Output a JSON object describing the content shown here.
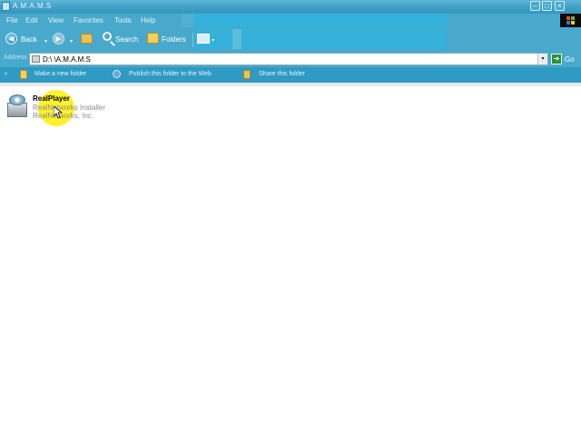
{
  "window": {
    "title": "A.M.A.M.S",
    "minimize_glyph": "–",
    "maximize_glyph": "□",
    "close_glyph": "×"
  },
  "menu": {
    "items": [
      "File",
      "Edit",
      "View",
      "Favorites",
      "Tools",
      "Help"
    ]
  },
  "toolbar": {
    "back_label": "Back",
    "search_label": "Search",
    "folders_label": "Folders",
    "back_glyph": "◀",
    "forward_glyph": "▶",
    "caret_glyph": "▾"
  },
  "address": {
    "label": "Address",
    "value": "D:\\ \\A.M.A.M.S",
    "go_label": "Go",
    "go_glyph": "➜",
    "dropdown_glyph": "▾"
  },
  "tasks": {
    "close_glyph": "✕",
    "items": [
      "Make a new folder",
      "Publish this folder to the Web",
      "Share this folder"
    ]
  },
  "files": [
    {
      "name": "RealPlayer",
      "description": "RealNetworks Installer",
      "company": "RealNetworks, Inc.",
      "icon": "installer-icon"
    }
  ],
  "colors": {
    "chrome": "#48a9cc",
    "highlight": "#33b2dd",
    "task_bar": "#2f9ac4",
    "cursor_highlight": "#ffee00"
  }
}
